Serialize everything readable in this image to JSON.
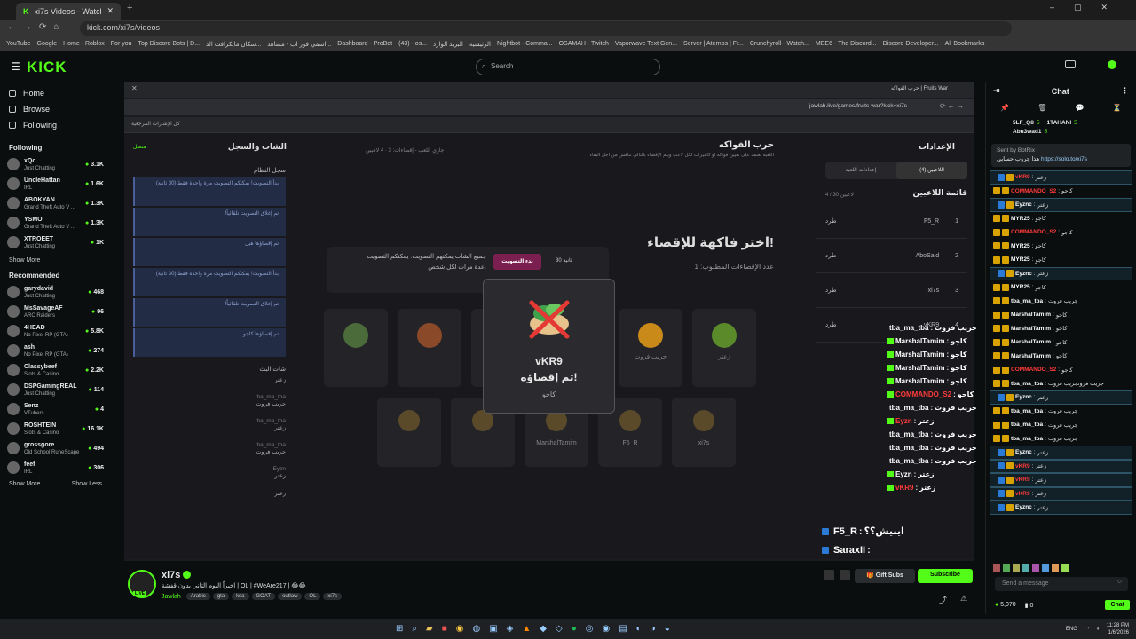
{
  "browser": {
    "tabs": [
      {
        "label": "xi7s Videos - Watch On-Demand"
      }
    ],
    "url": "kick.com/xi7s/videos",
    "bookmarks": [
      "YouTube",
      "Google",
      "Home - Roblox",
      "For you",
      "Top Discord Bots | D...",
      "سكان مايكرافت الد...",
      "اسمي فور اب - مشاهد...",
      "Dashboard - ProBot",
      "(43) - os...",
      "البريد الوارد",
      "الرئيسية",
      "Nightbot - Comma...",
      "OSAMAH - Twitch",
      "Vaporwave Text Gen...",
      "Server | Aternos | Fr...",
      "Crunchyroll - Watch...",
      "MEE6 - The Discord...",
      "Discord Developer...",
      "All Bookmarks"
    ]
  },
  "kick": {
    "logo": "KICK",
    "search_placeholder": "Search",
    "nav": [
      {
        "label": "Home",
        "icon": "home-icon"
      },
      {
        "label": "Browse",
        "icon": "browse-icon"
      },
      {
        "label": "Following",
        "icon": "heart-icon"
      }
    ],
    "following_title": "Following",
    "following": [
      {
        "name": "xQc",
        "game": "Just Chatting",
        "viewers": "3.1K"
      },
      {
        "name": "UncleHattan",
        "game": "IRL",
        "viewers": "1.6K"
      },
      {
        "name": "ABOKYAN",
        "game": "Grand Theft Auto V ...",
        "viewers": "1.3K"
      },
      {
        "name": "YSMO",
        "game": "Grand Theft Auto V ...",
        "viewers": "1.3K"
      },
      {
        "name": "XTROEET",
        "game": "Just Chatting",
        "viewers": "1K"
      }
    ],
    "show_more": "Show More",
    "recommended_title": "Recommended",
    "recommended": [
      {
        "name": "garydavid",
        "game": "Just Chatting",
        "viewers": "468"
      },
      {
        "name": "MsSavageAF",
        "game": "ARC Raiders",
        "viewers": "96"
      },
      {
        "name": "4HEAD",
        "game": "No Pixel RP (GTA)",
        "viewers": "5.8K"
      },
      {
        "name": "ash",
        "game": "No Pixel RP (GTA)",
        "viewers": "274"
      },
      {
        "name": "Classybeef",
        "game": "Slots & Casino",
        "viewers": "2.2K"
      },
      {
        "name": "DSPGamingREAL",
        "game": "Just Chatting",
        "viewers": "114"
      },
      {
        "name": "Senz",
        "game": "VTubers",
        "viewers": "4"
      },
      {
        "name": "ROSHTEIN",
        "game": "Slots & Casino",
        "viewers": "16.1K"
      },
      {
        "name": "grossgore",
        "game": "Old School RuneScape",
        "viewers": "494"
      },
      {
        "name": "feef",
        "game": "IRL",
        "viewers": "306"
      }
    ],
    "show_less": "Show Less"
  },
  "stream_browser": {
    "tab_label": "حرب الفواكه | Fruits War",
    "url": "jawlah.live/games/fruits-war?kick=xi7s",
    "bookmark": "كل الإشارات المرجعية"
  },
  "game": {
    "chat_log_title": "الشات والسجل",
    "system_log": "سجل النظام",
    "connected": "متصل",
    "title": "حرب الفواكه",
    "desc": "اللعبة تعتمد على تعيين فواكه أو كاميرات لكل لاعب ويتم الإقصاء بالتالي تنافس من أجل البقاء",
    "players_count": "4 لاعبين",
    "status": "جاري اللعب - إقصاءات: 3",
    "settings": "الإعدادات",
    "tab_players": "اللاعبين (4)",
    "tab_game_settings": "إعدادات اللعبة",
    "players_list_title": "قائمة اللاعبين",
    "players_sub": "4 / 30 لاعبين",
    "players": [
      {
        "rank": "1",
        "name": "F5_R",
        "kick": "طرد"
      },
      {
        "rank": "2",
        "name": "AboSaid",
        "kick": "طرد"
      },
      {
        "rank": "3",
        "name": "xi7s",
        "kick": "طرد"
      },
      {
        "rank": "4",
        "name": "vKR9",
        "kick": "طرد"
      }
    ],
    "choose_title": "اختر فاكهة للإقصاء!",
    "choose_sub": "عدد الإقصاءات المطلوب: 1",
    "vote_button": "بدء التصويت",
    "timer": "30 ثانية",
    "vote_info": "جميع الشات يمكنهم التصويت. يمكنكم التصويت عدة مرات لكل شخص.",
    "system_msgs": [
      "بدأ التصويت! يمكنكم التصويت مرة واحدة فقط (30 ثانية)",
      "تم إغلاق التصويت تلقائياً!",
      "تم إقصاؤها هيل",
      "بدأ التصويت! يمكنكم التصويت مرة واحدة فقط (30 ثانية)",
      "تم إغلاق التصويت تلقائياً!",
      "تم إقصاؤها كاجو"
    ],
    "live_chat_title": "شات البث",
    "live_chat": [
      {
        "user": "",
        "msg": "زعتر"
      },
      {
        "user": "tba_ma_tba",
        "msg": "جريب فروت"
      },
      {
        "user": "tba_ma_tba",
        "msg": "زعتر"
      },
      {
        "user": "tba_ma_tba",
        "msg": "جريب فروت"
      },
      {
        "user": "Eyzn",
        "msg": "زعتر"
      },
      {
        "user": "",
        "msg": "زعتر"
      }
    ],
    "fruits_top": [
      "",
      "",
      "",
      "",
      "جريب فروت",
      "زعتر"
    ],
    "fruits_bottom": [
      "",
      "",
      "MarshalTamim",
      "F5_R",
      "xi7s"
    ],
    "modal": {
      "name": "vKR9",
      "status": "تم إقصاؤه!",
      "fruit": "كاجو"
    }
  },
  "overlay_chat": [
    {
      "user": "tba_ma_tba",
      "msg": "جريب فروت",
      "color": "#ffffff"
    },
    {
      "user": "MarshalTamim",
      "msg": "كاجو",
      "color": "#ffffff"
    },
    {
      "user": "MarshalTamim",
      "msg": "كاجو",
      "color": "#ffffff"
    },
    {
      "user": "MarshalTamim",
      "msg": "كاجو",
      "color": "#ffffff"
    },
    {
      "user": "MarshalTamim",
      "msg": "كاجو",
      "color": "#ffffff"
    },
    {
      "user": "COMMANDO_S2",
      "msg": "كاجو",
      "color": "#ff3b3b"
    },
    {
      "user": "tba_ma_tba",
      "msg": "جريب فروت",
      "color": "#ffffff"
    },
    {
      "user": "Eyzn",
      "msg": "زعتر",
      "color": "#ff3b3b"
    },
    {
      "user": "tba_ma_tba",
      "msg": "جريب فروت",
      "color": "#ffffff"
    },
    {
      "user": "tba_ma_tba",
      "msg": "جريب فروت",
      "color": "#ffffff"
    },
    {
      "user": "tba_ma_tba",
      "msg": "جريب فروت",
      "color": "#ffffff"
    },
    {
      "user": "Eyzn",
      "msg": "زعتر",
      "color": "#ffffff"
    },
    {
      "user": "vKR9",
      "msg": "زعتر",
      "color": "#ff3b3b"
    }
  ],
  "overlay_bottom": [
    {
      "user": "F5_R",
      "msg": "ايبيش؟؟"
    },
    {
      "user": "SaraxII",
      "msg": ""
    },
    {
      "user": "SaraxII",
      "msg": ""
    },
    {
      "user": "araxII",
      "msg": "طول"
    }
  ],
  "channel": {
    "name": "xi7s",
    "title": "اخيراً اليوم التاني بدون قفشة | OL | #WeAre217 | 😂😂",
    "category": "Jawlah",
    "tags": [
      "Arabic",
      "gta",
      "ksa",
      "GOAT",
      "outlaw",
      "OL",
      "xi7s"
    ],
    "live_badge": "LIVE",
    "gift_subs": "Gift Subs",
    "subscribe": "Subscribe"
  },
  "chat": {
    "title": "Chat",
    "pinned_sender": "Sent by BotRix",
    "pinned_msg": "هذا جروب حسابي",
    "pinned_link": "https://solo.to/xi7s",
    "top_gifters": [
      {
        "name": "5LF_Q8",
        "count": "5"
      },
      {
        "name": "1TAHANI",
        "count": "5"
      },
      {
        "name": "Abu3wad1",
        "count": "5"
      }
    ],
    "messages": [
      {
        "user": "vKR9",
        "msg": "زعتر",
        "color": "#ff3b3b",
        "hl": true
      },
      {
        "user": "COMMANDO_S2",
        "msg": "كاجو",
        "color": "#ff3b3b",
        "hl": false
      },
      {
        "user": "Eyznc",
        "msg": "زعتر",
        "color": "#ffffff",
        "hl": true
      },
      {
        "user": "MYR25",
        "msg": "كاجو",
        "color": "#ffffff",
        "hl": false
      },
      {
        "user": "COMMANDO_S2",
        "msg": "كاجو",
        "color": "#ff3b3b",
        "hl": false
      },
      {
        "user": "MYR25",
        "msg": "كاجو",
        "color": "#ffffff",
        "hl": false
      },
      {
        "user": "MYR25",
        "msg": "كاجو",
        "color": "#ffffff",
        "hl": false
      },
      {
        "user": "Eyznc",
        "msg": "زعتر",
        "color": "#ffffff",
        "hl": true
      },
      {
        "user": "MYR25",
        "msg": "كاجو",
        "color": "#ffffff",
        "hl": false
      },
      {
        "user": "tba_ma_tba",
        "msg": "جريب فروت",
        "color": "#ffffff",
        "hl": false
      },
      {
        "user": "MarshalTamim",
        "msg": "كاجو",
        "color": "#ffffff",
        "hl": false
      },
      {
        "user": "MarshalTamim",
        "msg": "كاجو",
        "color": "#ffffff",
        "hl": false
      },
      {
        "user": "MarshalTamim",
        "msg": "كاجو",
        "color": "#ffffff",
        "hl": false
      },
      {
        "user": "MarshalTamim",
        "msg": "كاجو",
        "color": "#ffffff",
        "hl": false
      },
      {
        "user": "COMMANDO_S2",
        "msg": "كاجو",
        "color": "#ff3b3b",
        "hl": false
      },
      {
        "user": "tba_ma_tba",
        "msg": "جريب فروتجريب فروت",
        "color": "#ffffff",
        "hl": false
      },
      {
        "user": "Eyznc",
        "msg": "زعتر",
        "color": "#ffffff",
        "hl": true
      },
      {
        "user": "tba_ma_tba",
        "msg": "جريب فروت",
        "color": "#ffffff",
        "hl": false
      },
      {
        "user": "tba_ma_tba",
        "msg": "جريب فروت",
        "color": "#ffffff",
        "hl": false
      },
      {
        "user": "tba_ma_tba",
        "msg": "جريب فروت",
        "color": "#ffffff",
        "hl": false
      },
      {
        "user": "Eyznc",
        "msg": "زعتر",
        "color": "#ffffff",
        "hl": true
      },
      {
        "user": "vKR9",
        "msg": "زعتر",
        "color": "#ff3b3b",
        "hl": true
      },
      {
        "user": "vKR9",
        "msg": "زعتر",
        "color": "#ff3b3b",
        "hl": true
      },
      {
        "user": "vKR9",
        "msg": "زعتر",
        "color": "#ff3b3b",
        "hl": true
      },
      {
        "user": "Eyznc",
        "msg": "زعتر",
        "color": "#ffffff",
        "hl": true
      }
    ],
    "input_placeholder": "Send a message",
    "points": "5,070",
    "zero": "0",
    "chat_button": "Chat"
  },
  "taskbar": {
    "lang": "ENG",
    "time": "11:28 PM",
    "date": "1/6/2026"
  },
  "colors": {
    "kick_green": "#53fc18",
    "bg": "#0b0e0f",
    "danger": "#ff3b3b"
  }
}
